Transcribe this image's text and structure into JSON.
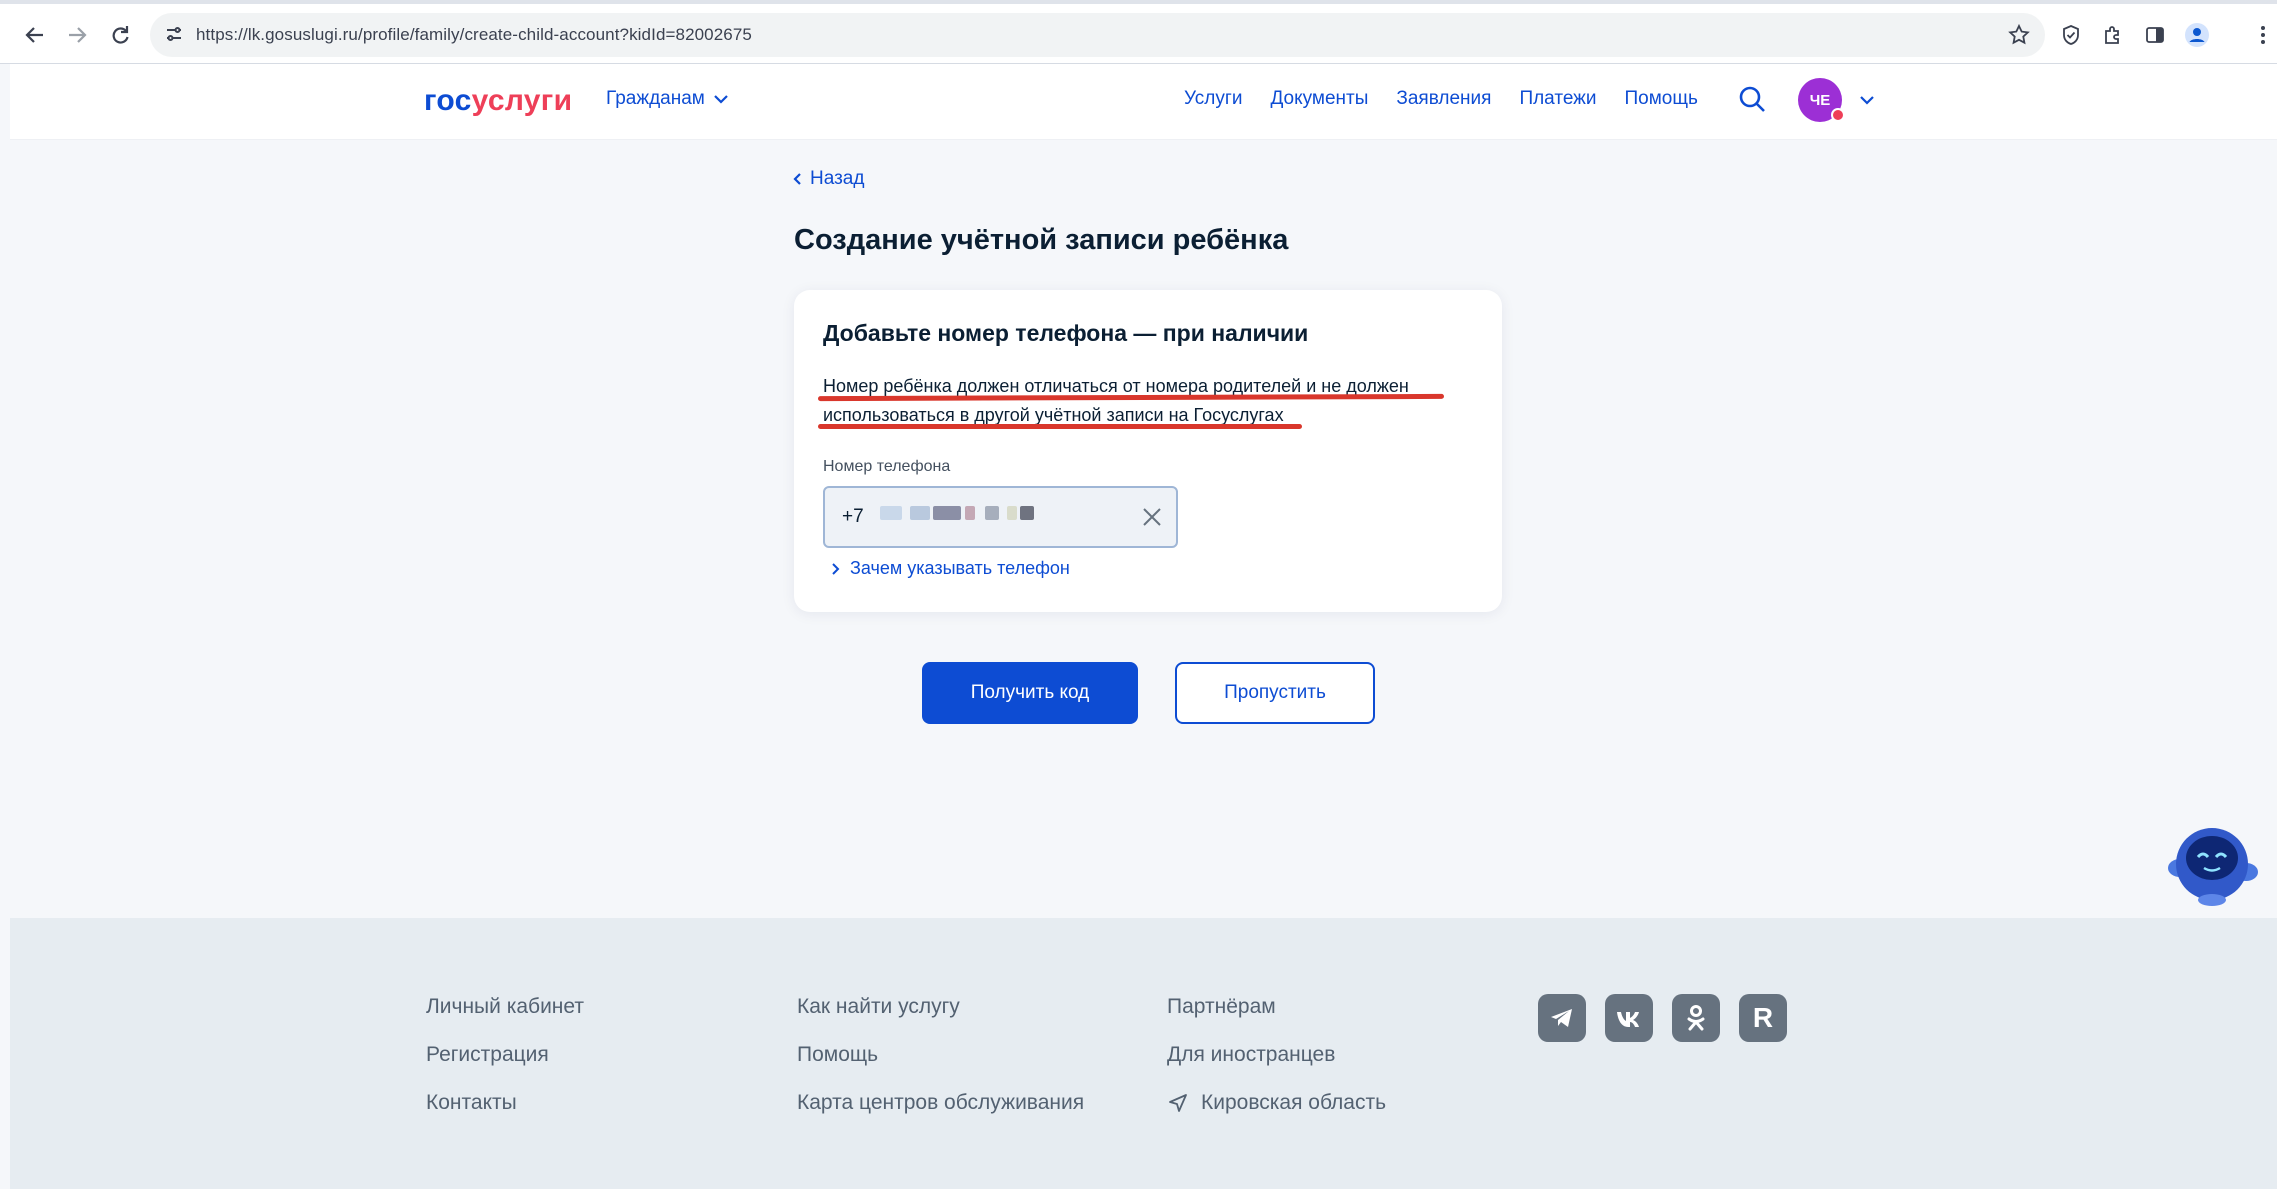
{
  "browser": {
    "url": "https://lk.gosuslugi.ru/profile/family/create-child-account?kidId=82002675"
  },
  "header": {
    "logo_part1": "гос",
    "logo_part2": "услуги",
    "citizens_label": "Гражданам",
    "nav": [
      "Услуги",
      "Документы",
      "Заявления",
      "Платежи",
      "Помощь"
    ],
    "avatar_initials": "ЧЕ"
  },
  "main": {
    "back_label": "Назад",
    "page_title": "Создание учётной записи ребёнка",
    "card": {
      "title": "Добавьте номер телефона — при наличии",
      "description": "Номер ребёнка должен отличаться от номера родителей и не должен использоваться в другой учётной записи на Госуслугах",
      "field_label": "Номер телефона",
      "field_prefix": "+7",
      "why_link": "Зачем указывать телефон"
    },
    "primary_button": "Получить код",
    "secondary_button": "Пропустить"
  },
  "footer": {
    "col1": [
      "Личный кабинет",
      "Регистрация",
      "Контакты"
    ],
    "col2": [
      "Как найти услугу",
      "Помощь",
      "Карта центров обслуживания"
    ],
    "col3": [
      "Партнёрам",
      "Для иностранцев"
    ],
    "region": "Кировская область",
    "social": [
      "telegram-icon",
      "vk-icon",
      "odnoklassniki-icon",
      "rutube-icon"
    ],
    "rutube_letter": "R"
  },
  "colors": {
    "brand_blue": "#0d4cd3",
    "brand_red": "#ee3f58",
    "underline_red": "#d9372c",
    "avatar_purple": "#9c2fd5"
  }
}
